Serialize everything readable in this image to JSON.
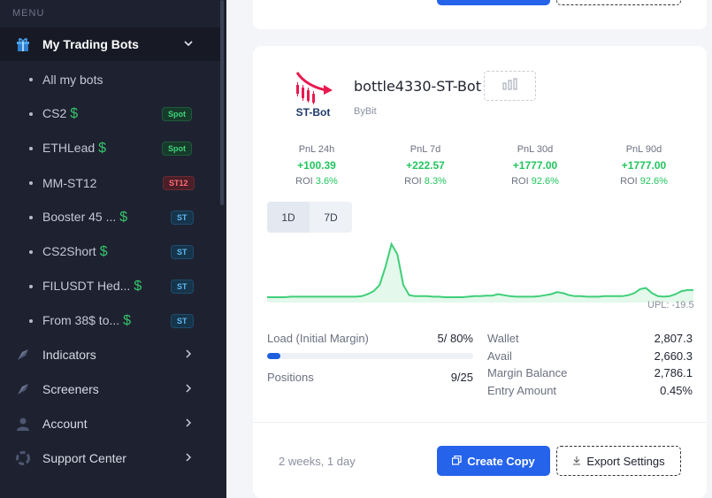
{
  "sidebar": {
    "menu_label": "MENU",
    "main_item": {
      "label": "My Trading Bots",
      "icon": "gift-icon"
    },
    "sub_items": [
      {
        "label": "All my bots",
        "dollar": "",
        "badge": ""
      },
      {
        "label": "CS2",
        "dollar": "$",
        "badge": "Spot",
        "badge_type": "spot"
      },
      {
        "label": "ETHLead",
        "dollar": "$",
        "badge": "Spot",
        "badge_type": "spot"
      },
      {
        "label": "MM-ST12",
        "dollar": "",
        "badge": "ST12",
        "badge_type": "st12"
      },
      {
        "label": "Booster 45 ...",
        "dollar": "$",
        "badge": "ST",
        "badge_type": "st"
      },
      {
        "label": "CS2Short",
        "dollar": "$",
        "badge": "ST",
        "badge_type": "st"
      },
      {
        "label": "FILUSDT Hed...",
        "dollar": "$",
        "badge": "ST",
        "badge_type": "st"
      },
      {
        "label": "From 38$ to...",
        "dollar": "$",
        "badge": "ST",
        "badge_type": "st"
      }
    ],
    "nav_items": [
      {
        "label": "Indicators",
        "icon": "rocket-icon"
      },
      {
        "label": "Screeners",
        "icon": "rocket-icon"
      },
      {
        "label": "Account",
        "icon": "user-icon"
      },
      {
        "label": "Support Center",
        "icon": "support-icon"
      }
    ]
  },
  "bot": {
    "logo_text": "ST-Bot",
    "name": "bottle4330-ST-Bot",
    "exchange": "ByBit",
    "pnl": [
      {
        "title": "PnL 24h",
        "value": "+100.39",
        "roi_label": "ROI",
        "roi": "3.6%"
      },
      {
        "title": "PnL 7d",
        "value": "+222.57",
        "roi_label": "ROI",
        "roi": "8.3%"
      },
      {
        "title": "PnL 30d",
        "value": "+1777.00",
        "roi_label": "ROI",
        "roi": "92.6%"
      },
      {
        "title": "PnL 90d",
        "value": "+1777.00",
        "roi_label": "ROI",
        "roi": "92.6%"
      }
    ],
    "range_tabs": [
      "1D",
      "7D"
    ],
    "upl": "UPL: -19.5",
    "load_label": "Load (Initial Margin)",
    "load_value": "5/ 80%",
    "load_progress": 0.0625,
    "positions_label": "Positions",
    "positions_value": "9/25",
    "wallet_label": "Wallet",
    "wallet_value": "2,807.3",
    "avail_label": "Avail",
    "avail_value": "2,660.3",
    "margin_label": "Margin Balance",
    "margin_value": "2,786.1",
    "entry_label": "Entry Amount",
    "entry_value": "0.45%",
    "age": "2 weeks, 1 day",
    "create_copy": "Create Copy",
    "export_settings": "Export Settings"
  },
  "colors": {
    "accent": "#2563eb",
    "positive": "#22c55e",
    "sidebar_bg": "#1e2230"
  },
  "chart_data": {
    "type": "area",
    "title": "",
    "xlabel": "",
    "ylabel": "",
    "values": [
      0,
      0,
      0,
      0,
      0.5,
      0.5,
      0.5,
      0.5,
      0.5,
      0.5,
      0.5,
      0.5,
      0.5,
      0.5,
      0.5,
      0.5,
      1,
      3,
      6,
      12,
      30,
      52,
      42,
      12,
      2,
      1,
      1,
      1,
      0.5,
      0.5,
      0,
      0,
      0,
      0,
      0.5,
      1,
      1,
      1.5,
      1.5,
      3,
      2,
      1,
      0.5,
      0.5,
      0.5,
      0.5,
      1,
      2,
      3,
      5,
      4,
      2,
      1,
      1,
      0.5,
      0.5,
      0.5,
      1,
      1,
      1,
      1,
      2,
      4,
      8,
      9,
      4,
      1,
      0.5,
      1,
      3,
      6,
      7,
      7
    ]
  }
}
